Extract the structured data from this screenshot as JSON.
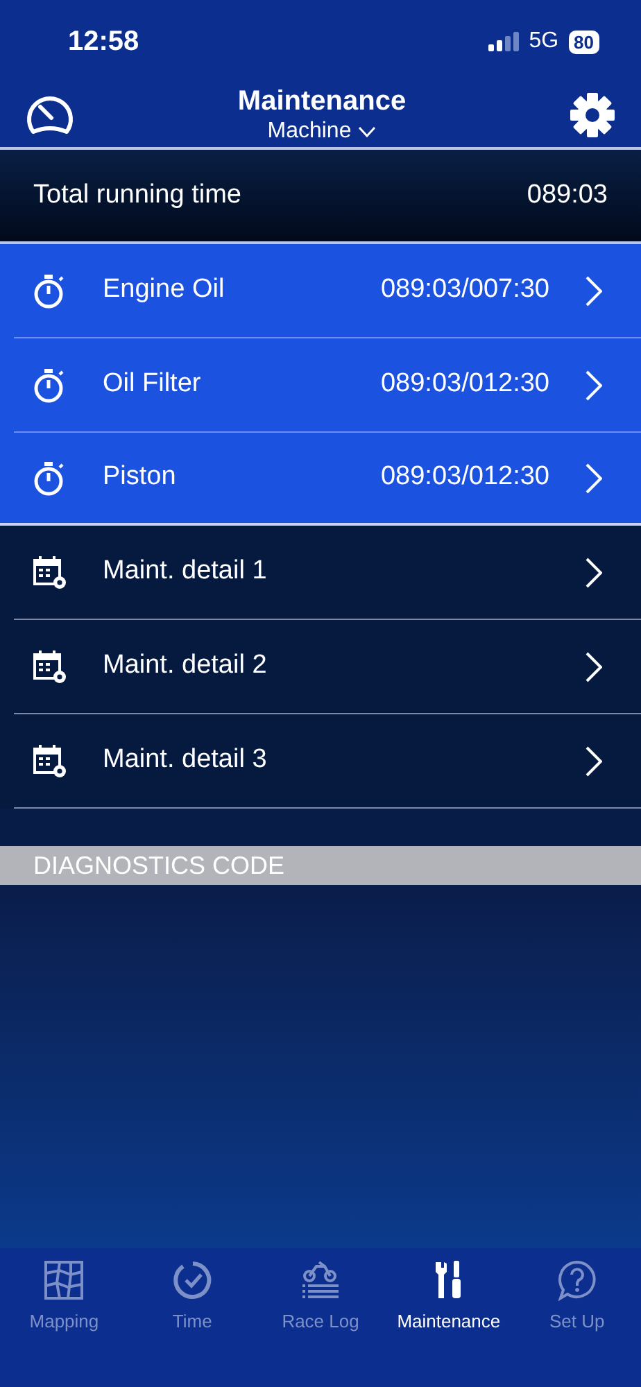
{
  "status_bar": {
    "time": "12:58",
    "network": "5G",
    "battery": "80"
  },
  "header": {
    "title": "Maintenance",
    "subtitle": "Machine"
  },
  "total": {
    "label": "Total running time",
    "value": "089:03"
  },
  "items": [
    {
      "kind": "timer",
      "label": "Engine Oil",
      "value": "089:03/007:30"
    },
    {
      "kind": "timer",
      "label": "Oil Filter",
      "value": "089:03/012:30"
    },
    {
      "kind": "timer",
      "label": "Piston",
      "value": "089:03/012:30"
    },
    {
      "kind": "schedule",
      "label": "Maint. detail 1"
    },
    {
      "kind": "schedule",
      "label": "Maint. detail 2"
    },
    {
      "kind": "schedule",
      "label": "Maint. detail 3"
    }
  ],
  "section": {
    "title": "DIAGNOSTICS CODE"
  },
  "tabs": [
    {
      "kind": "map",
      "label": "Mapping",
      "selected": false
    },
    {
      "kind": "time",
      "label": "Time",
      "selected": false
    },
    {
      "kind": "racelog",
      "label": "Race Log",
      "selected": false
    },
    {
      "kind": "tools",
      "label": "Maintenance",
      "selected": true
    },
    {
      "kind": "help",
      "label": "Set Up",
      "selected": false
    }
  ]
}
